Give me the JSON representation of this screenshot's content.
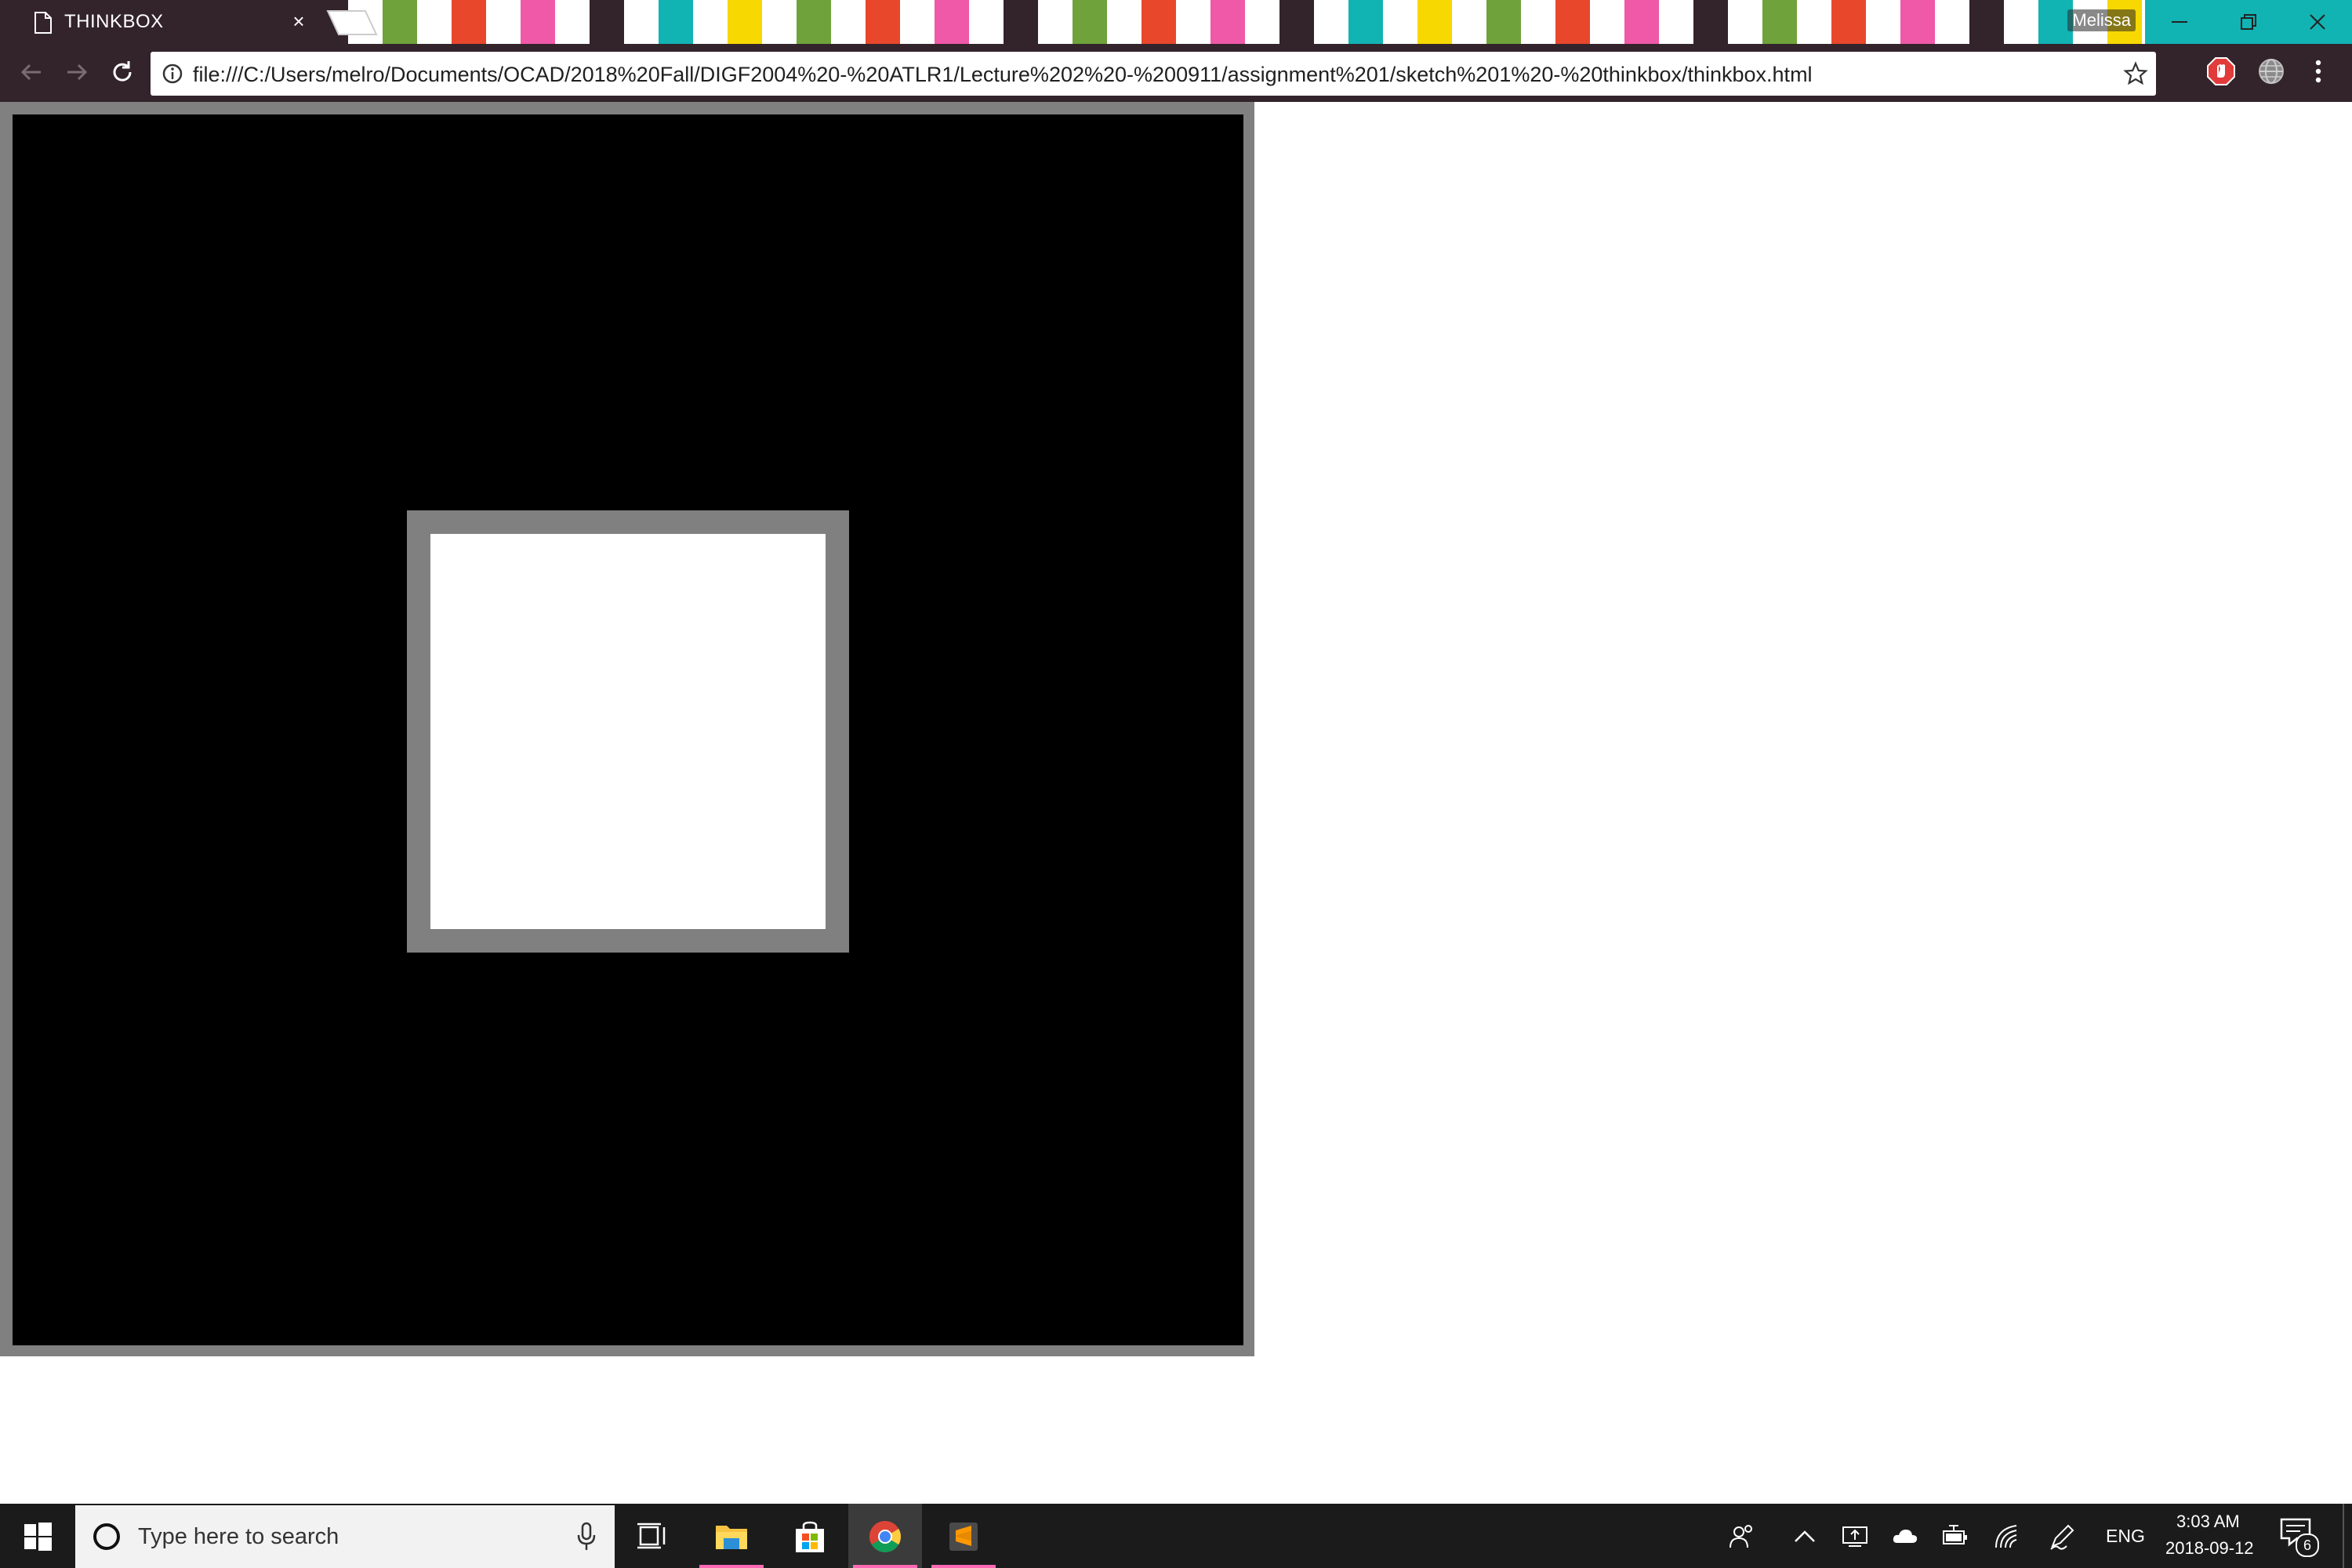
{
  "browser": {
    "tab": {
      "title": "THINKBOX",
      "close_glyph": "×",
      "icon": "document-icon"
    },
    "profile": {
      "name": "Melissa"
    },
    "window_controls": [
      "minimize",
      "restore",
      "close"
    ],
    "nav": {
      "back_icon": "arrow-left-icon",
      "forward_icon": "arrow-right-icon",
      "reload_icon": "reload-icon"
    },
    "address_bar": {
      "url": "file:///C:/Users/melro/Documents/OCAD/2018%20Fall/DIGF2004%20-%20ATLR1/Lecture%202%20-%200911/assignment%201/sketch%201%20-%20thinkbox/thinkbox.html",
      "info_icon": "info-icon",
      "bookmark_icon": "star-icon"
    },
    "extensions": [
      "adblock-icon",
      "globe-icon"
    ],
    "menu_icon": "kebab-menu-icon",
    "theme_colors": {
      "frame": "#33232b",
      "stripes": [
        "#ffffff",
        "#6fa23a",
        "#e8472c",
        "#f058a8",
        "#12b3b3",
        "#f7d800"
      ]
    }
  },
  "page": {
    "canvas_background": "#000000",
    "frame_color": "#808080",
    "inner_square_color": "#ffffff"
  },
  "taskbar": {
    "search_placeholder": "Type here to search",
    "language": "ENG",
    "time": "3:03 AM",
    "date": "2018-09-12",
    "notification_count": "6",
    "apps": [
      "task-view-icon",
      "file-explorer-icon",
      "microsoft-store-icon",
      "chrome-icon",
      "sublime-text-icon"
    ],
    "tray_icons": [
      "people-icon",
      "chevron-up-icon",
      "screen-icon",
      "onedrive-icon",
      "battery-icon",
      "wifi-icon",
      "pen-icon"
    ]
  }
}
